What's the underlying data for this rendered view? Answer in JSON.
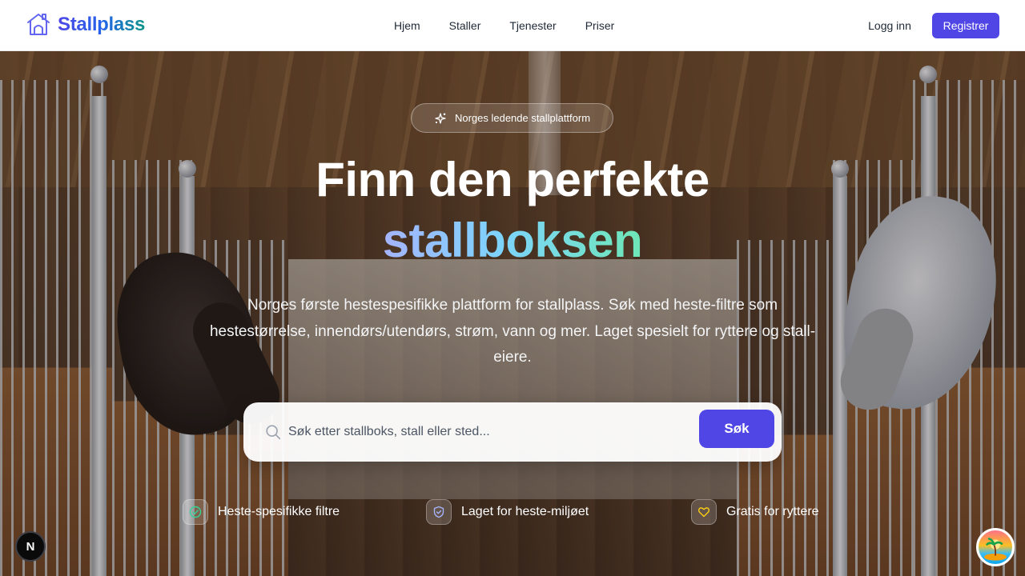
{
  "header": {
    "brand": "Stallplass",
    "nav": [
      "Hjem",
      "Staller",
      "Tjenester",
      "Priser"
    ],
    "login_label": "Logg inn",
    "register_label": "Registrer"
  },
  "hero": {
    "badge": "Norges ledende stallplattform",
    "title_line1": "Finn den perfekte",
    "title_line2": "stallboksen",
    "subtitle": "Norges første hestespesifikke plattform for stallplass. Søk med heste-filtre som hestestørrelse, innendørs/utendørs, strøm, vann og mer. Laget spesielt for ryttere og stall-eiere."
  },
  "search": {
    "placeholder": "Søk etter stallboks, stall eller sted...",
    "value": "",
    "button_label": "Søk"
  },
  "features": [
    {
      "label": "Heste-spesifikke filtre",
      "icon": "check-circle-icon"
    },
    {
      "label": "Laget for heste-miljøet",
      "icon": "shield-check-icon"
    },
    {
      "label": "Gratis for ryttere",
      "icon": "heart-icon"
    }
  ],
  "dev_badge": "N",
  "colors": {
    "primary": "#4f46e5",
    "check": "#34d399",
    "shield": "#a5b4fc",
    "heart": "#facc15"
  }
}
